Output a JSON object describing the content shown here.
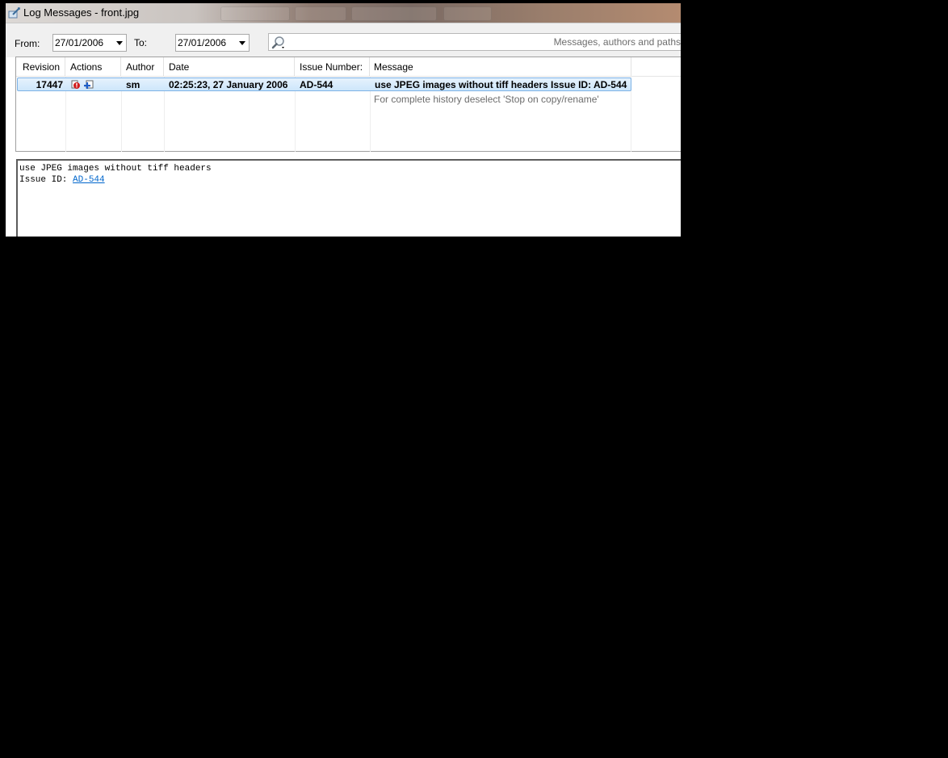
{
  "window": {
    "title": "Log Messages - front.jpg"
  },
  "filter": {
    "from_label": "From:",
    "from_value": "27/01/2006",
    "to_label": "To:",
    "to_value": "27/01/2006",
    "search_placeholder": "Messages, authors and paths"
  },
  "columns": [
    "Revision",
    "Actions",
    "Author",
    "Date",
    "Issue Number:",
    "Message"
  ],
  "rows": [
    {
      "revision": "17447",
      "actions": [
        "modified-icon",
        "added-icon"
      ],
      "author": "sm",
      "date": "02:25:23, 27 January 2006",
      "issue": "AD-544",
      "message": "use JPEG images without tiff headers Issue ID: AD-544"
    }
  ],
  "hint": "For complete history deselect 'Stop on copy/rename'",
  "detail": {
    "line1": "use JPEG images without tiff headers",
    "issue_label": "Issue ID: ",
    "issue_link": "AD-544"
  },
  "colors": {
    "selection_border": "#7db2e6",
    "link": "#0066cc"
  }
}
